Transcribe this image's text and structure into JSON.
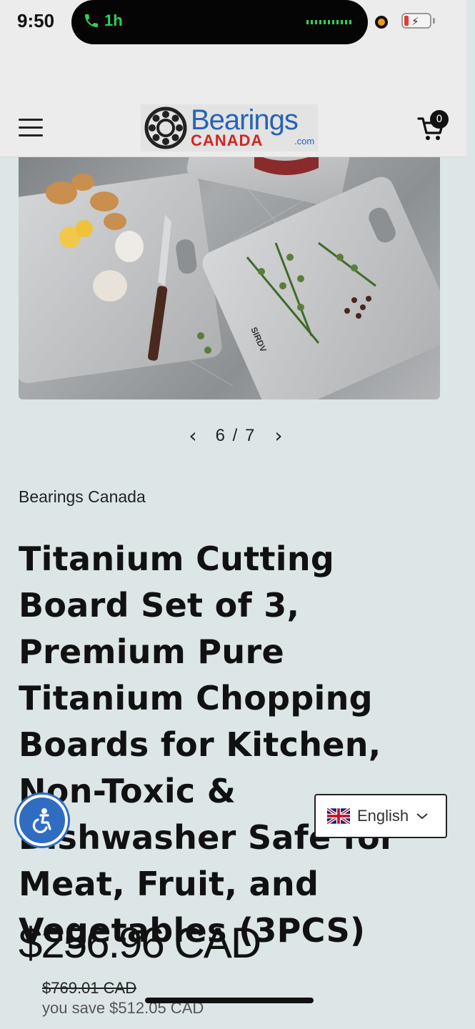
{
  "status_bar": {
    "time": "9:50",
    "call_duration": "1h"
  },
  "header": {
    "logo_word": "Bearings",
    "logo_sub": "CANADA",
    "logo_com": ".com",
    "cart_count": "0"
  },
  "gallery": {
    "prev": "‹",
    "next": "›",
    "counter": "6 / 7",
    "board_brand": "SIRDV"
  },
  "product": {
    "vendor": "Bearings Canada",
    "title": "Titanium Cutting Board Set of 3, Premium Pure Titanium Chopping Boards for Kitchen, Non-Toxic & Dishwasher Safe for Meat, Fruit, and Vegetables (3PCS)",
    "price": "$256.96 CAD",
    "compare_price": "$769.01 CAD",
    "you_save": "you save $512.05 CAD"
  },
  "language": {
    "selected": "English"
  },
  "colors": {
    "brand_blue": "#2763b3",
    "brand_red": "#d42424",
    "accessibility_blue": "#2f6dc2",
    "call_green": "#2fd158"
  }
}
